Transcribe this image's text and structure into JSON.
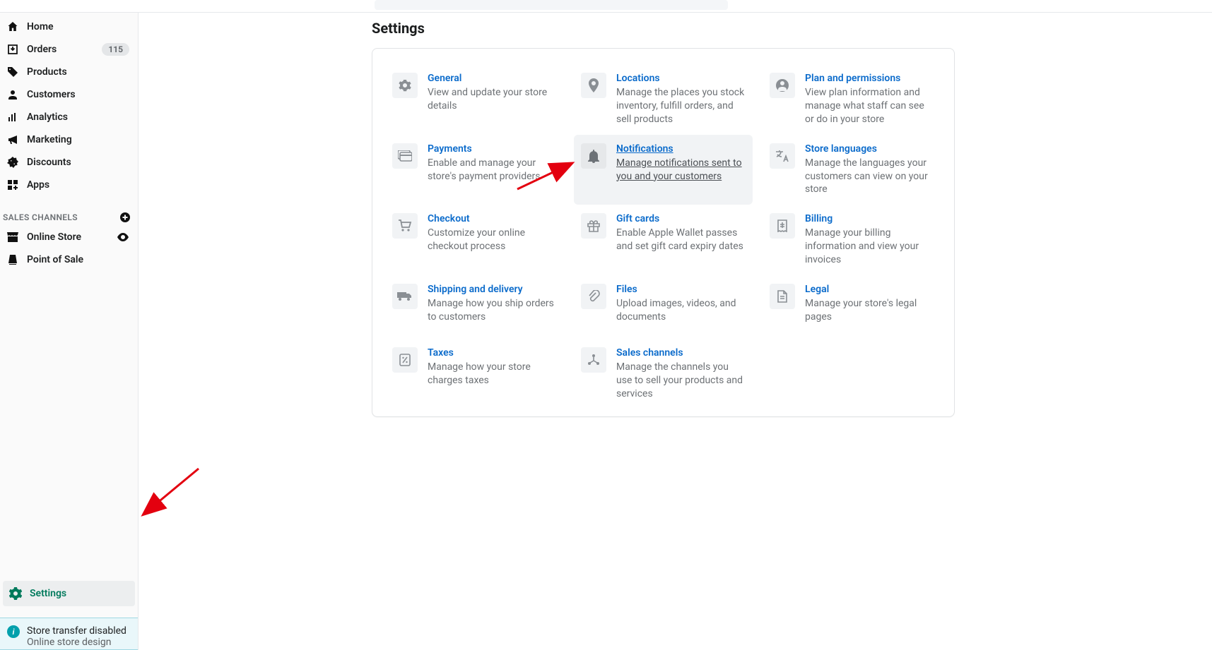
{
  "sidebar": {
    "nav": [
      {
        "key": "home",
        "label": "Home",
        "badge": null,
        "trail": null
      },
      {
        "key": "orders",
        "label": "Orders",
        "badge": "115",
        "trail": null
      },
      {
        "key": "products",
        "label": "Products",
        "badge": null,
        "trail": null
      },
      {
        "key": "customers",
        "label": "Customers",
        "badge": null,
        "trail": null
      },
      {
        "key": "analytics",
        "label": "Analytics",
        "badge": null,
        "trail": null
      },
      {
        "key": "marketing",
        "label": "Marketing",
        "badge": null,
        "trail": null
      },
      {
        "key": "discounts",
        "label": "Discounts",
        "badge": null,
        "trail": null
      },
      {
        "key": "apps",
        "label": "Apps",
        "badge": null,
        "trail": null
      }
    ],
    "section_title": "SALES CHANNELS",
    "channels": [
      {
        "key": "online-store",
        "label": "Online Store",
        "trail": "eye"
      },
      {
        "key": "point-of-sale",
        "label": "Point of Sale",
        "trail": null
      }
    ],
    "settings_label": "Settings",
    "banner": {
      "line1": "Store transfer disabled",
      "line2": "Online store design"
    }
  },
  "page": {
    "title": "Settings",
    "tiles": [
      {
        "key": "general",
        "title": "General",
        "desc": "View and update your store details",
        "icon": "gear"
      },
      {
        "key": "locations",
        "title": "Locations",
        "desc": "Manage the places you stock inventory, fulfill orders, and sell products",
        "icon": "pin"
      },
      {
        "key": "plan",
        "title": "Plan and permissions",
        "desc": "View plan information and manage what staff can see or do in your store",
        "icon": "user"
      },
      {
        "key": "payments",
        "title": "Payments",
        "desc": "Enable and manage your store's payment providers",
        "icon": "card"
      },
      {
        "key": "notifications",
        "title": "Notifications",
        "desc": "Manage notifications sent to you and your customers",
        "icon": "bell",
        "hover": true
      },
      {
        "key": "languages",
        "title": "Store languages",
        "desc": "Manage the languages your customers can view on your store",
        "icon": "translate"
      },
      {
        "key": "checkout",
        "title": "Checkout",
        "desc": "Customize your online checkout process",
        "icon": "cart"
      },
      {
        "key": "giftcards",
        "title": "Gift cards",
        "desc": "Enable Apple Wallet passes and set gift card expiry dates",
        "icon": "gift"
      },
      {
        "key": "billing",
        "title": "Billing",
        "desc": "Manage your billing information and view your invoices",
        "icon": "receipt"
      },
      {
        "key": "shipping",
        "title": "Shipping and delivery",
        "desc": "Manage how you ship orders to customers",
        "icon": "truck"
      },
      {
        "key": "files",
        "title": "Files",
        "desc": "Upload images, videos, and documents",
        "icon": "clip"
      },
      {
        "key": "legal",
        "title": "Legal",
        "desc": "Manage your store's legal pages",
        "icon": "doc"
      },
      {
        "key": "taxes",
        "title": "Taxes",
        "desc": "Manage how your store charges taxes",
        "icon": "percent"
      },
      {
        "key": "saleschannels",
        "title": "Sales channels",
        "desc": "Manage the channels you use to sell your products and services",
        "icon": "share"
      },
      null
    ]
  }
}
